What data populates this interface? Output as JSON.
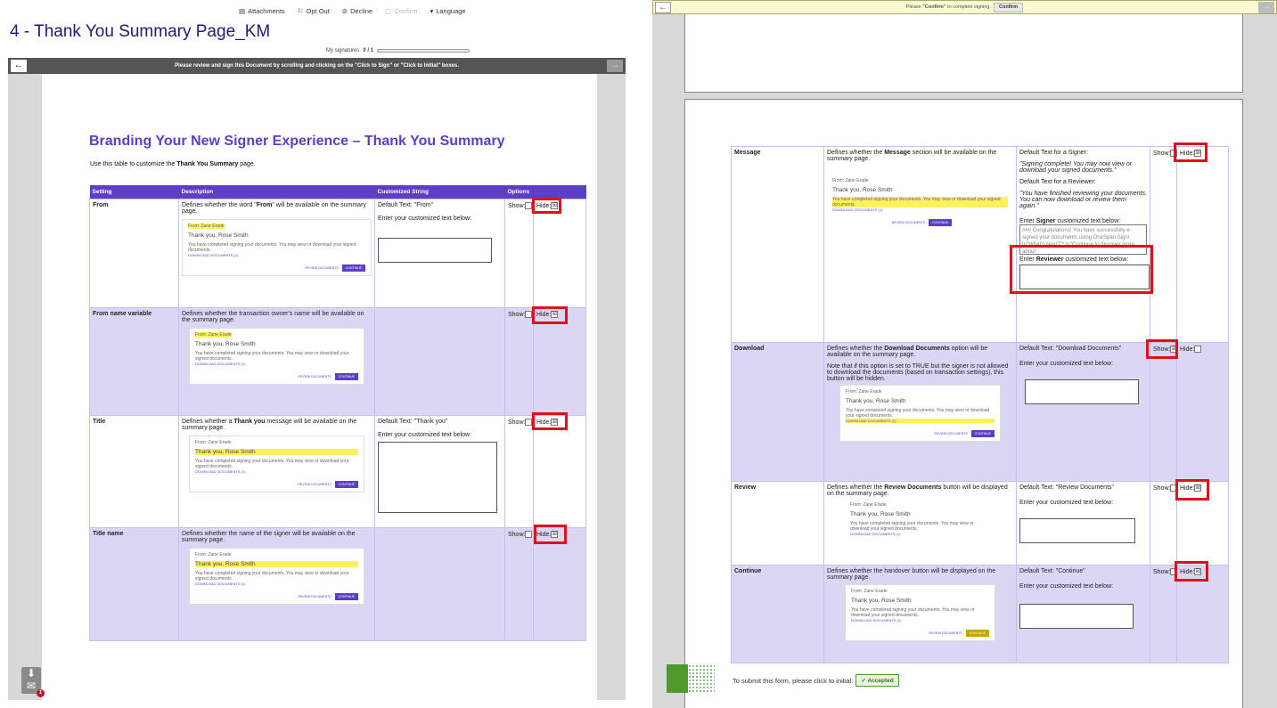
{
  "toolbar": {
    "attachments": "Attachments",
    "opt_out": "Opt Out",
    "decline": "Decline",
    "confirm": "Confirm",
    "language": "Language"
  },
  "doc_title": "4 - Thank You Summary Page_KM",
  "my_signatures": {
    "label": "My signatures",
    "value": "0 / 1",
    "progress": 0
  },
  "nav_message": "Please review and sign this Document by scrolling and clicking on the \"Click to Sign\" or \"Click to Initial\" boxes.",
  "heading": "Branding Your New Signer Experience – Thank You Summary",
  "intro": {
    "prefix": "Use this table to customize the ",
    "bold": "Thank You Summary",
    "suffix": " page."
  },
  "table_headers": [
    "Setting",
    "Description",
    "Customized String",
    "Options"
  ],
  "mock": {
    "from": "From: Zane Erade",
    "from_hl": "From: Zane Erade",
    "thanks": "Thank you, Rose Smith",
    "body": "You have completed signing your documents. You may view or download your signed documents.",
    "download": "DOWNLOAD DOCUMENTS (1)",
    "review_btn": "REVIEW DOCUMENTS",
    "continue_btn": "CONTINUE"
  },
  "rows_left": [
    {
      "setting": "From",
      "desc_pre": "Defines whether the word \"",
      "desc_bold": "From",
      "desc_post": "\" will be available on the summary page.",
      "default": "Default Text: \"From\"",
      "enter": "Enter your customized text below:",
      "show": "Show:",
      "hide": "Hide:"
    },
    {
      "setting": "From name variable",
      "desc": "Defines whether the transaction owner's name will be available on the summary page.",
      "show": "Show:",
      "hide": "Hide:"
    },
    {
      "setting": "Title",
      "desc_pre": "Defines whether a ",
      "desc_bold": "Thank you",
      "desc_post": " message will be available on the summary page.",
      "default": "Default Text: \"Thank you\"",
      "enter": "Enter your customized text below:",
      "show": "Show:",
      "hide": "Hide:"
    },
    {
      "setting": "Title name",
      "desc": "Defines whether the name of the signer will be available on the summary page.",
      "show": "Show:",
      "hide": "Hide:"
    }
  ],
  "right_banner": {
    "pre": "Please ",
    "bold": "\"Confirm\"",
    "post": " to complete signing.",
    "button": "Confirm"
  },
  "rows_right": [
    {
      "setting": "Message",
      "desc_pre": "Defines whether the ",
      "desc_bold": "Message",
      "desc_post": " section will be available on the summary page.",
      "default_signer": "Default Text for a Signer:",
      "signer_text": "\"Signing complete! You may now view or download your signed documents.\"",
      "default_reviewer": "Default Text for a Reviewer:",
      "reviewer_text": "\"You have finished reviewing your documents. You can now download or review them again.\"",
      "enter_pre": "Enter ",
      "enter_bold": "Signer",
      "enter_post": " customized text below:",
      "textarea": "### Congratulations! You have successfully e-signed your documents using OneSpan Sign! \\n\"What's Next?\"* \\n\"Continue to discover more about",
      "enter_reviewer_pre": "Enter ",
      "enter_reviewer_bold": "Reviewer",
      "enter_reviewer_post": " customized text below:",
      "show": "Show:",
      "hide": "Hide:"
    },
    {
      "setting": "Download",
      "desc_pre": "Defines whether the ",
      "desc_bold": "Download Documents",
      "desc_post": " option will be available on the summary page.",
      "note": "Note that if this option is set to TRUE but the signer is not allowed to download the documents (based on transaction settings), this button will be hidden.",
      "default": "Default Text: \"Download Documents\"",
      "enter": "Enter your customized text below:",
      "show": "Show:",
      "hide": "Hide:"
    },
    {
      "setting": "Review",
      "desc_pre": "Defines whether the ",
      "desc_bold": "Review Documents",
      "desc_post": " button will be displayed on the summary page.",
      "default": "Default Text: \"Review Documents\"",
      "enter": "Enter your customized text below:",
      "show": "Show:",
      "hide": "Hide:"
    },
    {
      "setting": "Continue",
      "desc": "Defines whether the handover button will be displayed on the summary page.",
      "default": "Default Text: \"Continue\"",
      "enter": "Enter your customized text below:",
      "show": "Show:",
      "hide": "Hide:"
    }
  ],
  "submit_label": "To submit this form, please click to initial:",
  "accepted": "Accepted",
  "badge_count": "1",
  "colors": {
    "accent": "#5b3fc4",
    "highlight": "#e01020",
    "row_alt": "#dcd6f5"
  }
}
